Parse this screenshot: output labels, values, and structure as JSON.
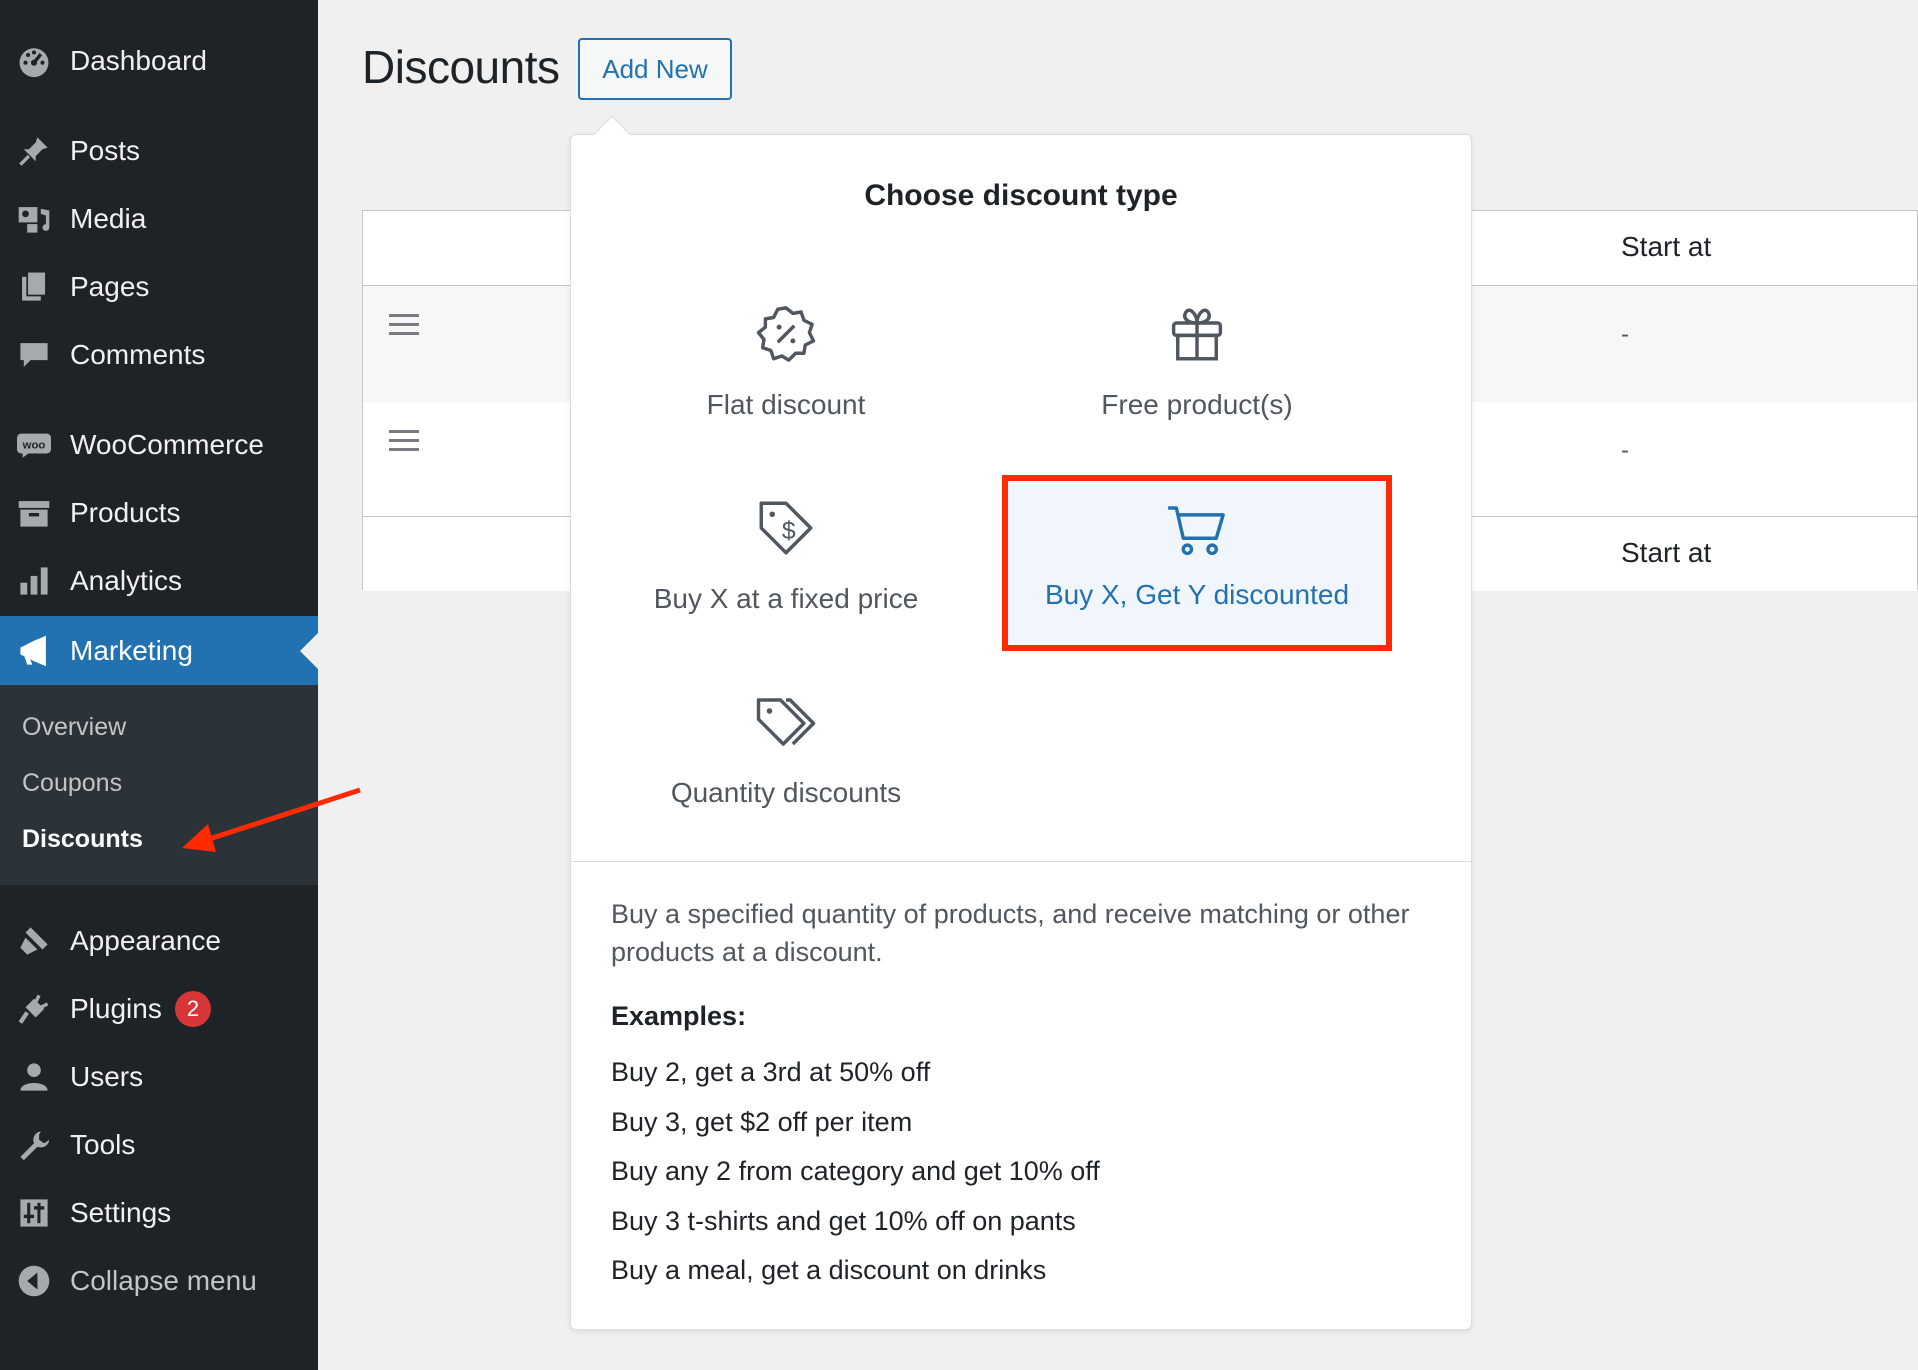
{
  "sidebar": {
    "items": [
      {
        "label": "Dashboard",
        "icon": "dashboard-icon"
      },
      {
        "label": "Posts",
        "icon": "pin-icon"
      },
      {
        "label": "Media",
        "icon": "media-icon"
      },
      {
        "label": "Pages",
        "icon": "pages-icon"
      },
      {
        "label": "Comments",
        "icon": "comment-icon"
      },
      {
        "label": "WooCommerce",
        "icon": "woo-icon",
        "icon_text": "woo"
      },
      {
        "label": "Products",
        "icon": "archive-icon"
      },
      {
        "label": "Analytics",
        "icon": "bar-chart-icon"
      },
      {
        "label": "Marketing",
        "icon": "megaphone-icon"
      },
      {
        "label": "Appearance",
        "icon": "brush-icon"
      },
      {
        "label": "Plugins",
        "icon": "plug-icon",
        "badge": "2"
      },
      {
        "label": "Users",
        "icon": "user-icon"
      },
      {
        "label": "Tools",
        "icon": "wrench-icon"
      },
      {
        "label": "Settings",
        "icon": "sliders-icon"
      },
      {
        "label": "Collapse menu",
        "icon": "collapse-icon"
      }
    ],
    "submenu": [
      "Overview",
      "Coupons",
      "Discounts"
    ],
    "active": "Marketing",
    "current_sub": "Discounts"
  },
  "header": {
    "title": "Discounts",
    "add_new_label": "Add New"
  },
  "table": {
    "column_start_at": "Start at",
    "rows": [
      {
        "start_at": "-"
      },
      {
        "start_at": "-"
      }
    ],
    "footer_start_at": "Start at"
  },
  "popover": {
    "title": "Choose discount type",
    "options": [
      {
        "label": "Flat discount",
        "icon": "percent-badge-icon"
      },
      {
        "label": "Free product(s)",
        "icon": "gift-icon"
      },
      {
        "label": "Buy X at a fixed price",
        "icon": "dollar-tag-icon"
      },
      {
        "label": "Buy X, Get Y discounted",
        "icon": "cart-icon",
        "selected": true
      },
      {
        "label": "Quantity discounts",
        "icon": "tags-icon"
      }
    ],
    "description": "Buy a specified quantity of products, and receive matching or other products at a discount.",
    "examples_title": "Examples:",
    "examples": [
      "Buy 2, get a 3rd at 50% off",
      "Buy 3, get $2 off per item",
      "Buy any 2 from category and get 10% off",
      "Buy 3 t-shirts and get 10% off on pants",
      "Buy a meal, get a discount on drinks"
    ]
  },
  "colors": {
    "sidebar_bg": "#1d2327",
    "submenu_bg": "#2c3338",
    "accent": "#2271b1",
    "highlight_border": "#ff2a00",
    "badge": "#d63638",
    "annotation_arrow": "#ff2a00"
  }
}
